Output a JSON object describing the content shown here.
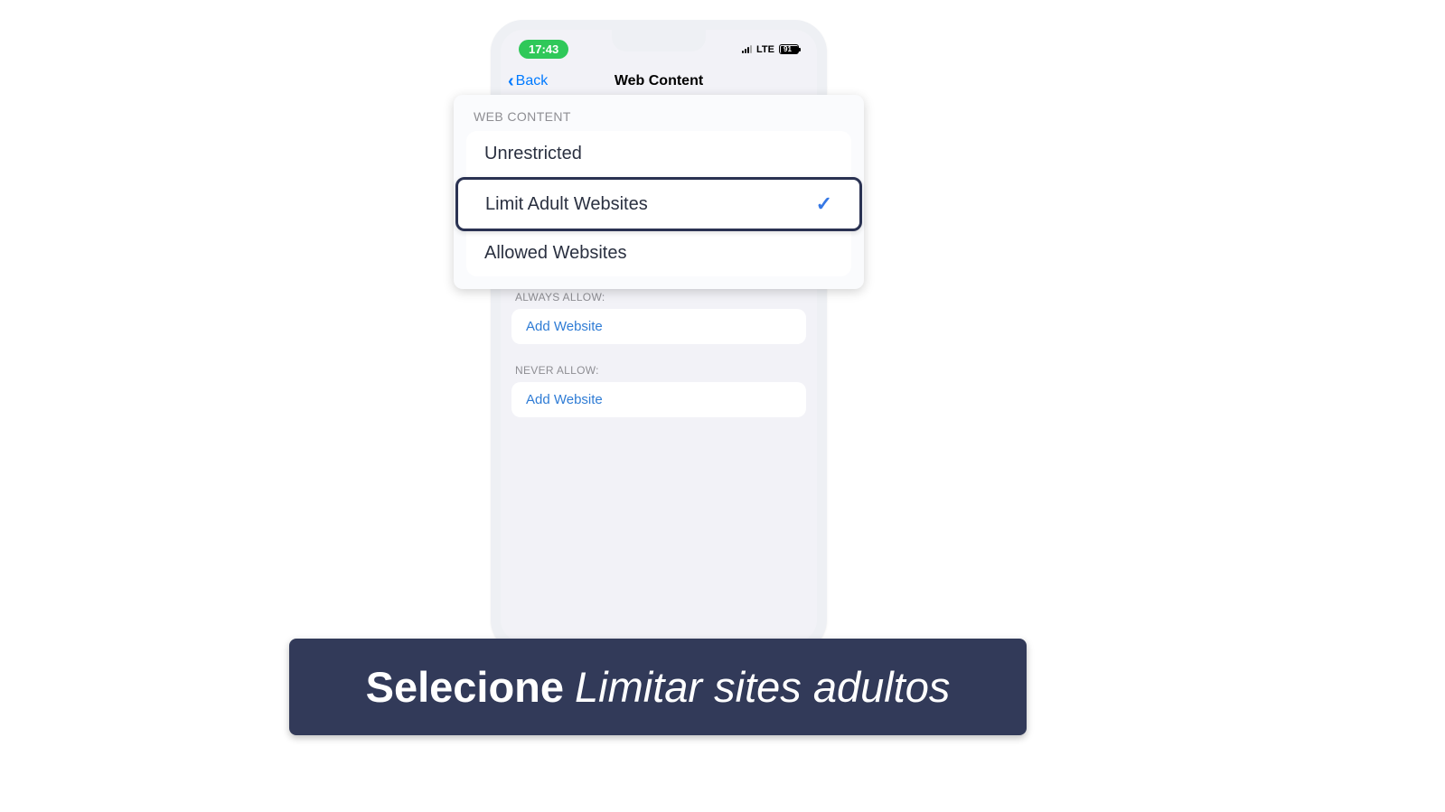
{
  "statusBar": {
    "time": "17:43",
    "network": "LTE",
    "battery": "91"
  },
  "nav": {
    "back": "Back",
    "title": "Web Content"
  },
  "overlay": {
    "header": "WEB CONTENT",
    "options": {
      "unrestricted": "Unrestricted",
      "limitAdult": "Limit Adult Websites",
      "allowed": "Allowed Websites"
    }
  },
  "sections": {
    "alwaysAllow": "ALWAYS ALLOW:",
    "neverAllow": "NEVER ALLOW:",
    "addWebsite": "Add Website"
  },
  "caption": {
    "prefix": "Selecione",
    "italic": "Limitar sites adultos"
  }
}
